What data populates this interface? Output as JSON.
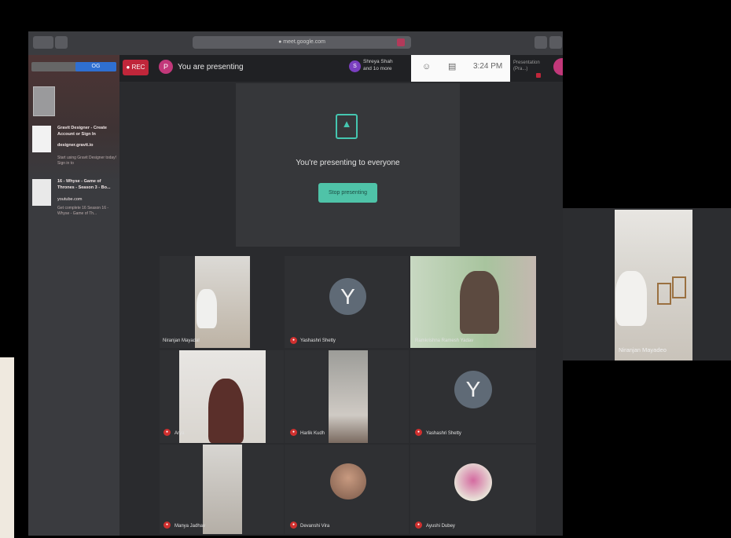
{
  "browser": {
    "url_text": "● meet.google.com"
  },
  "sidebar": {
    "segment_right_label": "OG",
    "results": [
      {
        "title": "Gravit Designer - Create Account or Sign In",
        "title2": "designer.gravit.io",
        "sub": "Start using Gravit Designer today! Sign in to"
      },
      {
        "title": "16 - Whyse - Game of Thrones - Season 3 - Bo...",
        "title2": "youtube.com",
        "sub": "Get complete 16 Season 16 - Whyse - Game of Th..."
      }
    ]
  },
  "meet": {
    "rec_label": "● REC",
    "presenter_initial": "P",
    "presenting_label": "You are presenting",
    "joined_initial": "S",
    "joined_text_1": "Shreya Shah",
    "joined_text_2": "and 1o more",
    "time": "3:24 PM",
    "presenter_tag_1": "Presentation",
    "presenter_tag_2": "(Pra...)"
  },
  "presentation": {
    "message": "You're presenting to everyone",
    "stop_label": "Stop presenting"
  },
  "participants": [
    {
      "name": "Niranjan Mayadal"
    },
    {
      "name": "Yashashri Shetty",
      "initial": "Y"
    },
    {
      "name": "Ramkrishna Ramesh Yadav"
    },
    {
      "name": "Arya"
    },
    {
      "name": "Harlik Kudh"
    },
    {
      "name": "Yashashri Shetty",
      "initial": "Y"
    },
    {
      "name": "Manya Jadhav"
    },
    {
      "name": "Devanshi Vira"
    },
    {
      "name": "Ayushi Dubey"
    }
  ],
  "floating_tile": {
    "name": "Niranjan Mayadeo"
  },
  "colors": {
    "accent_green": "#4fc3a8",
    "rec_red": "#c0263a",
    "avatar_pink": "#c2387a",
    "avatar_purple": "#7a3fc0",
    "y_avatar": "#5f6a76"
  }
}
